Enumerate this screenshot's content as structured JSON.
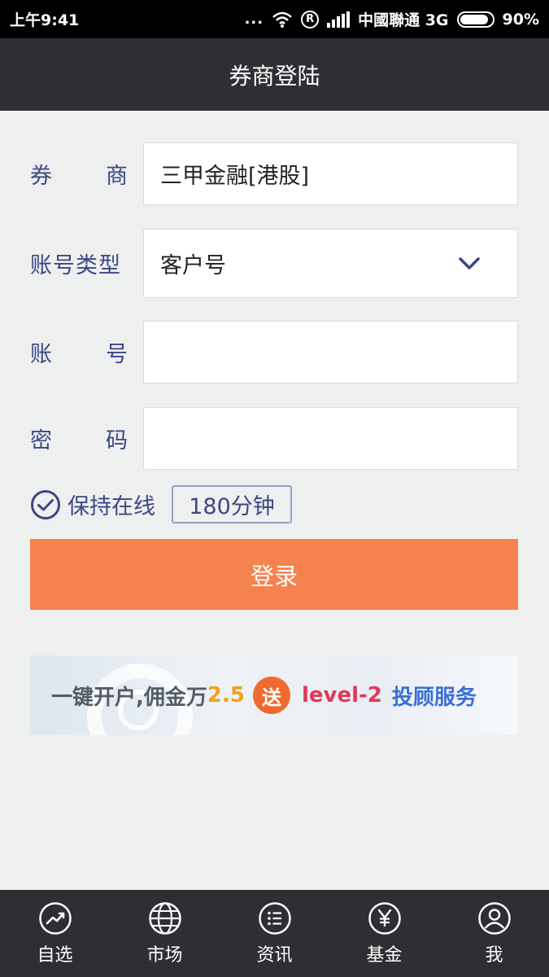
{
  "status_bar": {
    "time": "上午9:41",
    "dots": "...",
    "reg": "R",
    "carrier": "中國聯通 3G",
    "battery": "90%"
  },
  "header": {
    "title": "券商登陆"
  },
  "form": {
    "broker_label_a": "券",
    "broker_label_b": "商",
    "broker_value": "三甲金融[港股]",
    "account_type_label": "账号类型",
    "account_type_value": "客户号",
    "account_label_a": "账",
    "account_label_b": "号",
    "account_value": "",
    "password_label_a": "密",
    "password_label_b": "码",
    "password_value": ""
  },
  "keep_online": {
    "label": "保持在线",
    "duration": "180分钟"
  },
  "login_button": {
    "label": "登录"
  },
  "banner": {
    "text1": "一键开户,佣金万",
    "number": "2.5",
    "gift": "送",
    "level": "level-2",
    "service": "投顾服务"
  },
  "tabs": [
    {
      "label": "自选",
      "icon": "trend-icon"
    },
    {
      "label": "市场",
      "icon": "globe-icon"
    },
    {
      "label": "资讯",
      "icon": "list-icon"
    },
    {
      "label": "基金",
      "icon": "yen-icon"
    },
    {
      "label": "我",
      "icon": "user-icon"
    }
  ],
  "colors": {
    "accent": "#f6824f",
    "label": "#3c4784",
    "header_bg": "#2e2f33"
  }
}
